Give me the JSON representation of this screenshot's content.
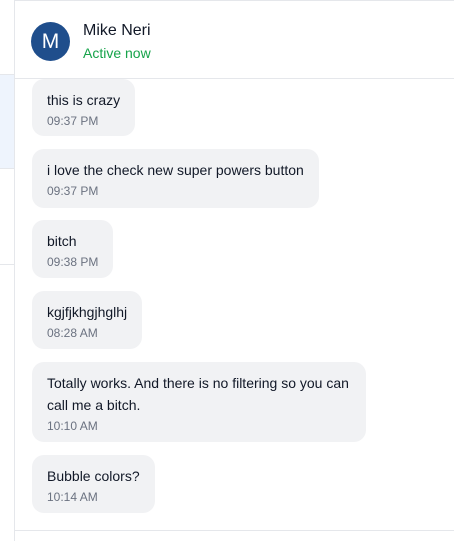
{
  "contact": {
    "initial": "M",
    "name": "Mike Neri",
    "status": "Active now",
    "avatar_color": "#1f4e8c",
    "status_color": "#16a34a"
  },
  "messages": [
    {
      "text": "this is crazy",
      "time": "09:37 PM"
    },
    {
      "text": "i love the check new super powers button",
      "time": "09:37 PM"
    },
    {
      "text": "bitch",
      "time": "09:38 PM"
    },
    {
      "text": "kgjfjkhgjhglhj",
      "time": "08:28 AM"
    },
    {
      "text": "Totally works. And there is no filtering so you can call me a bitch.",
      "time": "10:10 AM"
    },
    {
      "text": "Bubble colors?",
      "time": "10:14 AM"
    }
  ],
  "colors": {
    "bubble_bg": "#f1f2f4",
    "selected_row_bg": "#eef4fd"
  }
}
